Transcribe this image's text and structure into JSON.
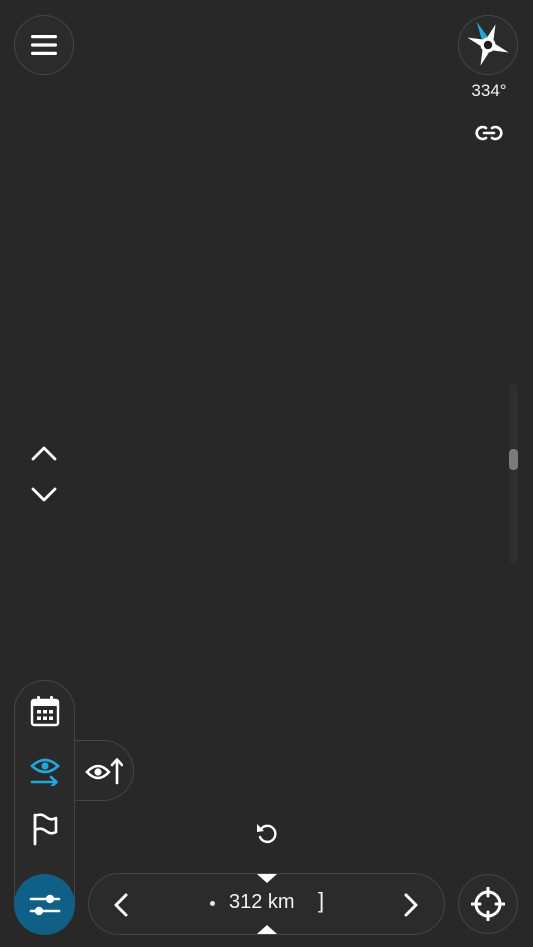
{
  "header": {
    "menu_icon": "hamburger-menu-icon",
    "compass_icon": "compass-icon",
    "heading": "334°",
    "link_icon": "link-icon"
  },
  "map_controls": {
    "pitch_up_icon": "chevron-up-icon",
    "pitch_down_icon": "chevron-down-icon",
    "zoom_scroll_position": 0.41
  },
  "side_panel": {
    "items": [
      {
        "icon": "calendar-icon"
      },
      {
        "icon": "eye-direction-icon",
        "active": true
      },
      {
        "icon": "flag-icon"
      }
    ],
    "extension_icon": "eye-up-icon",
    "settings_icon": "sliders-icon"
  },
  "bottom": {
    "undo_icon": "undo-icon",
    "scale_label": "312 km",
    "scale_bracket": "]",
    "prev_icon": "chevron-left-icon",
    "next_icon": "chevron-right-icon",
    "locate_icon": "crosshair-icon"
  },
  "colors": {
    "background": "#282828",
    "accent": "#1fa8dc",
    "settings_button": "#0f5f86"
  }
}
